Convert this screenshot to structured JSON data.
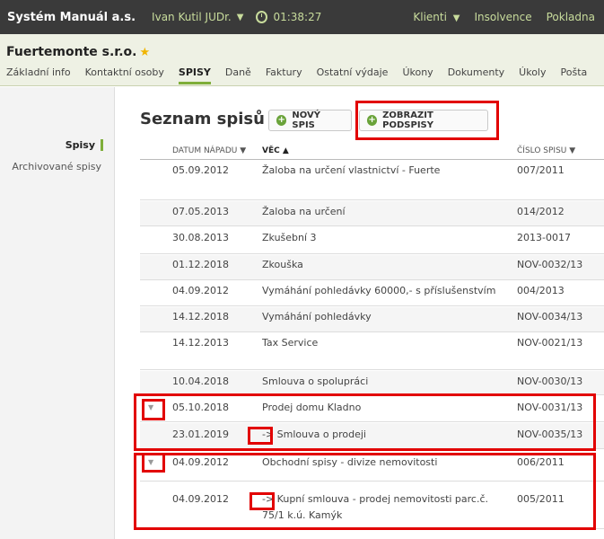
{
  "topbar": {
    "brand": "Systém Manuál a.s.",
    "user": "Ivan Kutil JUDr.",
    "timer": "01:38:27",
    "nav": [
      "Klienti",
      "Insolvence",
      "Pokladna"
    ]
  },
  "client": {
    "name": "Fuertemonte s.r.o.",
    "tabs": [
      "Základní info",
      "Kontaktní osoby",
      "SPISY",
      "Daně",
      "Faktury",
      "Ostatní výdaje",
      "Úkony",
      "Dokumenty",
      "Úkoly",
      "Pošta"
    ],
    "active_tab": "SPISY"
  },
  "sidebar": {
    "items": [
      "Spisy",
      "Archivované spisy"
    ]
  },
  "main": {
    "title": "Seznam spisů",
    "new_button": "NOVÝ SPIS",
    "show_button": "ZOBRAZIT PODSPISY",
    "headers": {
      "date": "DATUM NÁPADU ▼",
      "vec": "VĚC ▲",
      "num": "ČÍSLO SPISU ▼"
    },
    "rows": [
      {
        "date": "05.09.2012",
        "vec": "Žaloba na určení vlastnictví - Fuerte",
        "num": "007/2011"
      },
      {
        "date": "07.05.2013",
        "vec": "Žaloba na určení",
        "num": "014/2012"
      },
      {
        "date": "30.08.2013",
        "vec": "Zkušební 3",
        "num": "2013-0017"
      },
      {
        "date": "01.12.2018",
        "vec": "Zkouška",
        "num": "NOV-0032/13"
      },
      {
        "date": "04.09.2012",
        "vec": "Vymáhání pohledávky 60000,- s příslušenstvím",
        "num": "004/2013"
      },
      {
        "date": "14.12.2018",
        "vec": "Vymáhání pohledávky",
        "num": "NOV-0034/13"
      },
      {
        "date": "14.12.2013",
        "vec": "Tax Service",
        "num": "NOV-0021/13"
      },
      {
        "date": "10.04.2018",
        "vec": "Smlouva o spolupráci",
        "num": "NOV-0030/13"
      },
      {
        "date": "05.10.2018",
        "vec": "Prodej domu Kladno",
        "num": "NOV-0031/13"
      },
      {
        "date": "23.01.2019",
        "vec": "-> Smlouva o prodeji",
        "num": "NOV-0035/13"
      },
      {
        "date": "04.09.2012",
        "vec": "Obchodní spisy - divize nemovitosti",
        "num": "006/2011"
      },
      {
        "date": "04.09.2012",
        "vec": "-> Kupní smlouva - prodej nemovitosti parc.č. 75/1 k.ú. Kamýk",
        "num": "005/2011"
      }
    ],
    "expander_icon": "triangle-down-icon"
  }
}
